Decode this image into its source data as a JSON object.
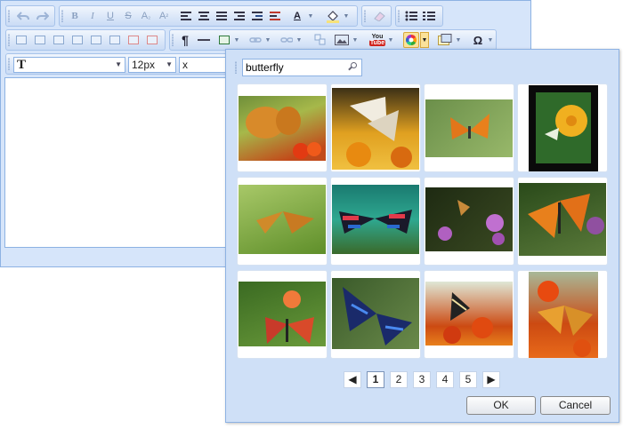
{
  "font_row": {
    "font_size": "12px",
    "font_name_prefix": "x"
  },
  "toolbar": {
    "bold": "B",
    "italic": "I",
    "underline": "U",
    "strike": "S",
    "subscript": "A",
    "sub_mark": "₂",
    "superscript": "A",
    "sup_mark": "²",
    "font_color": "A",
    "paragraph": "¶",
    "special_char": "Ω",
    "youtube_top": "You",
    "youtube_bottom": "Tube"
  },
  "dialog": {
    "search_value": "butterfly",
    "pages": [
      "1",
      "2",
      "3",
      "4",
      "5"
    ],
    "current_page": "1",
    "prev_label": "◀",
    "next_label": "▶",
    "ok_label": "OK",
    "cancel_label": "Cancel"
  },
  "colors": {
    "window_bg": "#d6e5fa",
    "dialog_bg": "#cfe0f7",
    "border": "#8db2e3"
  }
}
